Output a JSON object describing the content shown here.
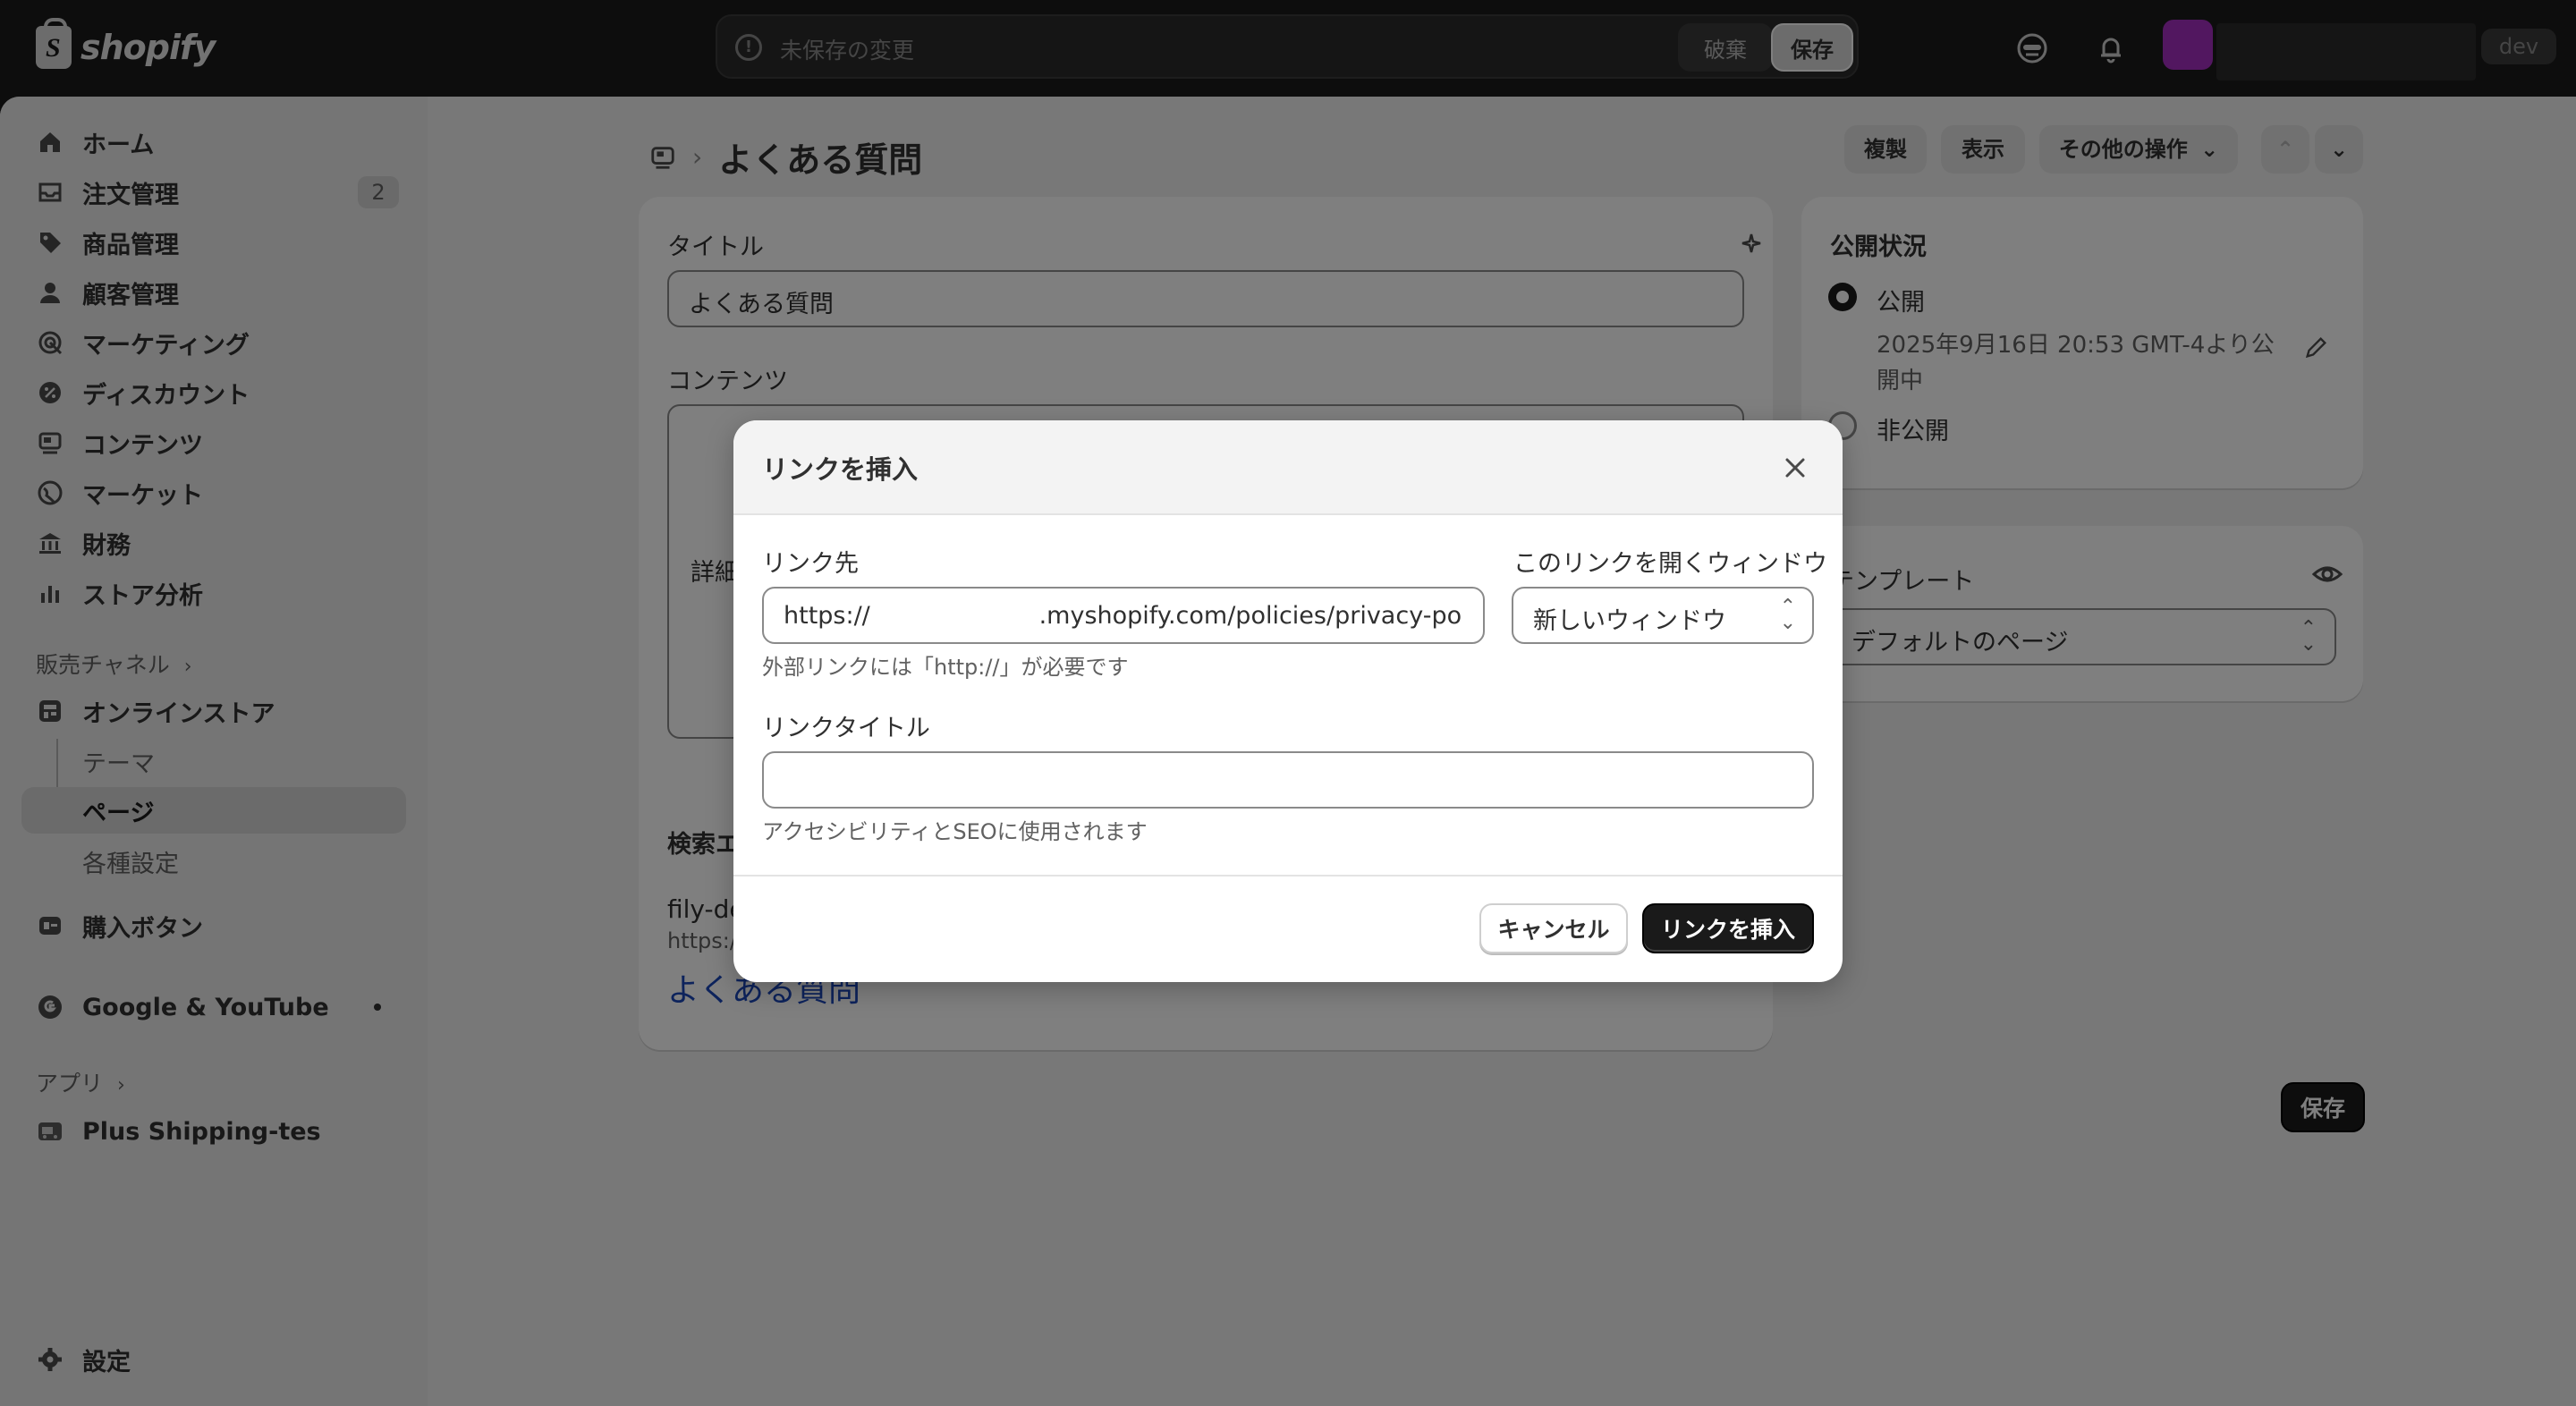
{
  "topbar": {
    "logo_text": "shopify",
    "unsaved_message": "未保存の変更",
    "discard_label": "破棄",
    "save_label": "保存",
    "dev_badge": "dev"
  },
  "sidebar": {
    "items": [
      {
        "label": "ホーム",
        "icon": "home-icon"
      },
      {
        "label": "注文管理",
        "icon": "inbox-icon",
        "badge": "2"
      },
      {
        "label": "商品管理",
        "icon": "tag-icon"
      },
      {
        "label": "顧客管理",
        "icon": "person-icon"
      },
      {
        "label": "マーケティング",
        "icon": "target-icon"
      },
      {
        "label": "ディスカウント",
        "icon": "discount-icon"
      },
      {
        "label": "コンテンツ",
        "icon": "content-icon"
      },
      {
        "label": "マーケット",
        "icon": "globe-icon"
      },
      {
        "label": "財務",
        "icon": "bank-icon"
      },
      {
        "label": "ストア分析",
        "icon": "chart-icon"
      }
    ],
    "sales_channels_label": "販売チャネル",
    "online_store": {
      "label": "オンラインストア",
      "subitems": [
        "テーマ",
        "ページ",
        "各種設定"
      ]
    },
    "buy_button_label": "購入ボタン",
    "google_label": "Google & YouTube",
    "apps_label": "アプリ",
    "app_item_label": "Plus Shipping-tes",
    "settings_label": "設定"
  },
  "page": {
    "title": "よくある質問",
    "actions": {
      "duplicate": "複製",
      "view": "表示",
      "more": "その他の操作"
    },
    "title_label": "タイトル",
    "title_value": "よくある質問",
    "content_label": "コンテンツ",
    "content_partial": "詳細",
    "seo_label_partial": "検索エ",
    "seo_store_partial": "fily-de",
    "seo_url_partial": "https:/",
    "seo_link_title": "よくある質問",
    "bottom_save": "保存"
  },
  "visibility": {
    "heading": "公開状況",
    "published_label": "公開",
    "published_detail": "2025年9月16日 20:53 GMT-4より公開中",
    "unpublished_label": "非公開"
  },
  "template": {
    "heading": "テンプレート",
    "value": "デフォルトのページ"
  },
  "modal": {
    "title": "リンクを挿入",
    "link_to_label": "リンク先",
    "link_to_value": "https://                      .myshopify.com/policies/privacy-policy",
    "link_to_help": "外部リンクには「http://」が必要です",
    "open_in_label": "このリンクを開くウィンドウ",
    "open_in_value": "新しいウィンドウ",
    "link_title_label": "リンクタイトル",
    "link_title_value": "",
    "link_title_help": "アクセシビリティとSEOに使用されます",
    "cancel_label": "キャンセル",
    "insert_label": "リンクを挿入"
  }
}
